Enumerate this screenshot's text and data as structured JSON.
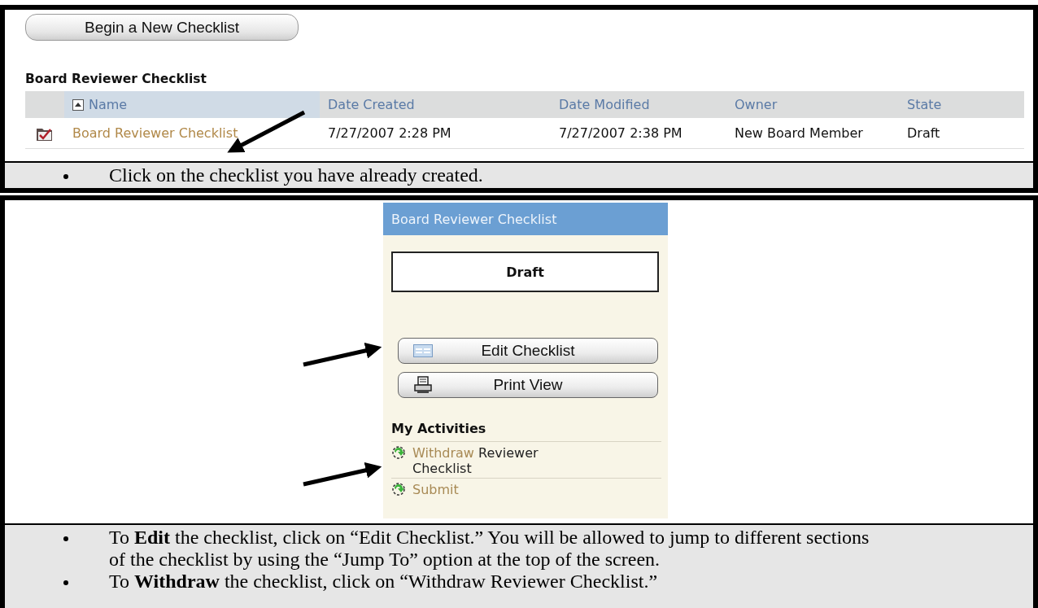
{
  "new_checklist_button": "Begin a New Checklist",
  "list": {
    "title": "Board Reviewer Checklist",
    "columns": [
      {
        "label": "Name",
        "sorted": true
      },
      {
        "label": "Date Created",
        "sorted": false
      },
      {
        "label": "Date Modified",
        "sorted": false
      },
      {
        "label": "Owner",
        "sorted": false
      },
      {
        "label": "State",
        "sorted": false
      }
    ],
    "rows": [
      {
        "cells": [
          "Board Reviewer Checklist",
          "7/27/2007 2:28 PM",
          "7/27/2007 2:38 PM",
          "New Board Member",
          "Draft"
        ]
      }
    ]
  },
  "notes_top": [
    "Click on the checklist you have already created."
  ],
  "panel": {
    "title": "Board Reviewer Checklist",
    "state": "Draft",
    "buttons": [
      {
        "label": "Edit Checklist",
        "kind": "edit"
      },
      {
        "label": "Print View",
        "kind": "print"
      }
    ],
    "activities_title": "My Activities",
    "activities": [
      {
        "link": "Withdraw",
        "text": "Reviewer Checklist"
      },
      {
        "link": "Submit"
      }
    ]
  },
  "notes_bottom": [
    "To **Edit** the checklist, click on “Edit Checklist.”  You will be allowed to jump to different sections of the checklist by using the “Jump To” option at the top of the screen.",
    "To **Withdraw** the checklist, click on “Withdraw Reviewer Checklist.”"
  ]
}
